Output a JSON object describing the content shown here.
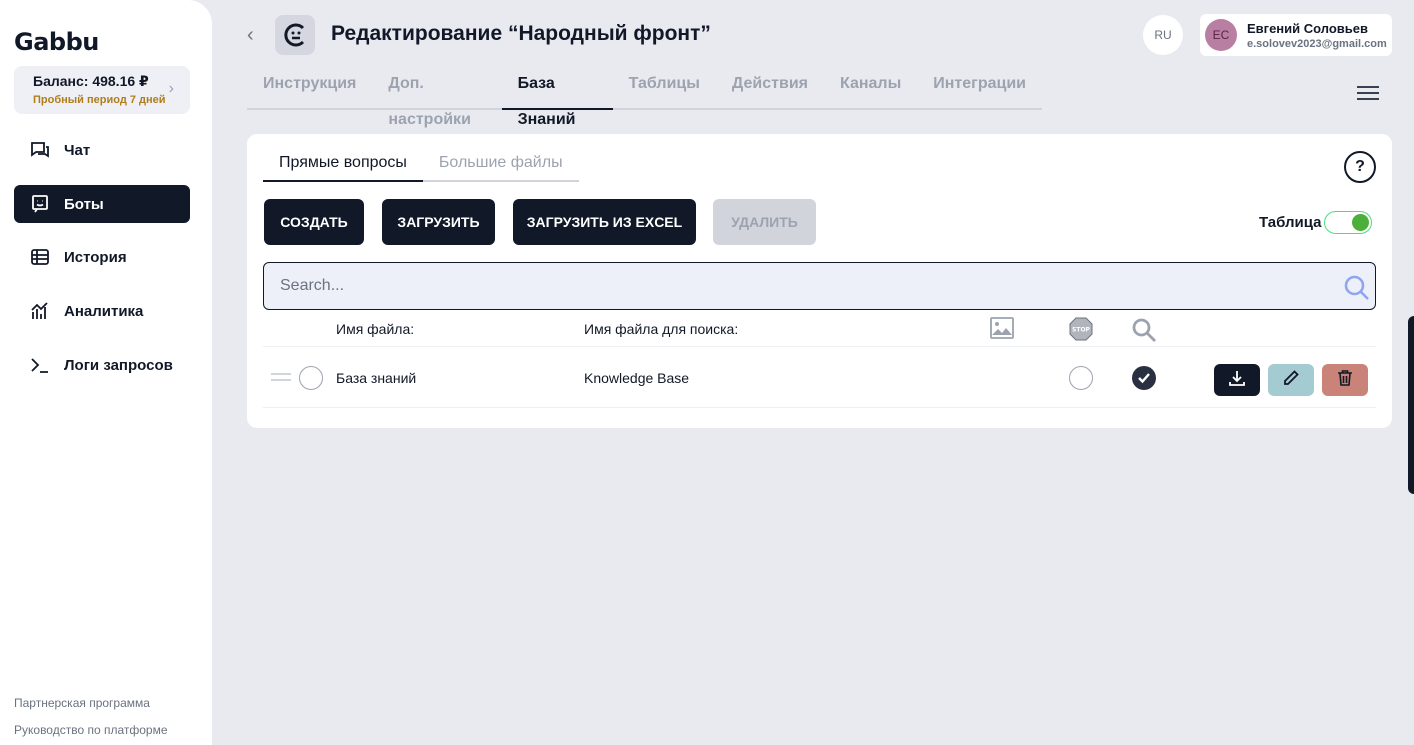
{
  "sidebar": {
    "logo": "Gabbu",
    "balance": "Баланс: 498.16 ₽",
    "trial": "Пробный период 7 дней",
    "items": [
      {
        "label": "Чат",
        "icon": "chat-icon"
      },
      {
        "label": "Боты",
        "icon": "bot-icon",
        "active": true
      },
      {
        "label": "История",
        "icon": "history-icon"
      },
      {
        "label": "Аналитика",
        "icon": "analytics-icon"
      },
      {
        "label": "Логи запросов",
        "icon": "terminal-icon"
      }
    ],
    "footer": {
      "partner": "Партнерская программа",
      "guide": "Руководство по платформе"
    }
  },
  "header": {
    "title": "Редактирование “Народный фронт”",
    "lang": "RU",
    "user": {
      "initials": "ЕС",
      "name": "Евгений Соловьев",
      "email": "e.solovev2023@gmail.com"
    }
  },
  "tabs": [
    "Инструкция",
    "Доп. настройки",
    "База Знаний",
    "Таблицы",
    "Действия",
    "Каналы",
    "Интеграции"
  ],
  "active_tab": "База Знаний",
  "card": {
    "subtabs": [
      "Прямые вопросы",
      "Большие файлы"
    ],
    "help": "?",
    "buttons": {
      "create": "СОЗДАТЬ",
      "upload": "ЗАГРУЗИТЬ",
      "upload_excel": "ЗАГРУЗИТЬ ИЗ EXCEL",
      "delete": "УДАЛИТЬ"
    },
    "table_toggle_label": "Таблица",
    "table_toggle_on": true,
    "search_placeholder": "Search...",
    "columns": {
      "file_name": "Имя файла:",
      "search_name": "Имя файла для поиска:"
    },
    "rows": [
      {
        "file_name": "База знаний",
        "search_name": "Knowledge Base",
        "stop": false,
        "search": true
      }
    ]
  },
  "colors": {
    "primary": "#111827",
    "toggle_on": "#4caf3a",
    "edit_btn": "#a4cbd1",
    "delete_btn": "#c98378",
    "trial": "#b07d1c"
  }
}
